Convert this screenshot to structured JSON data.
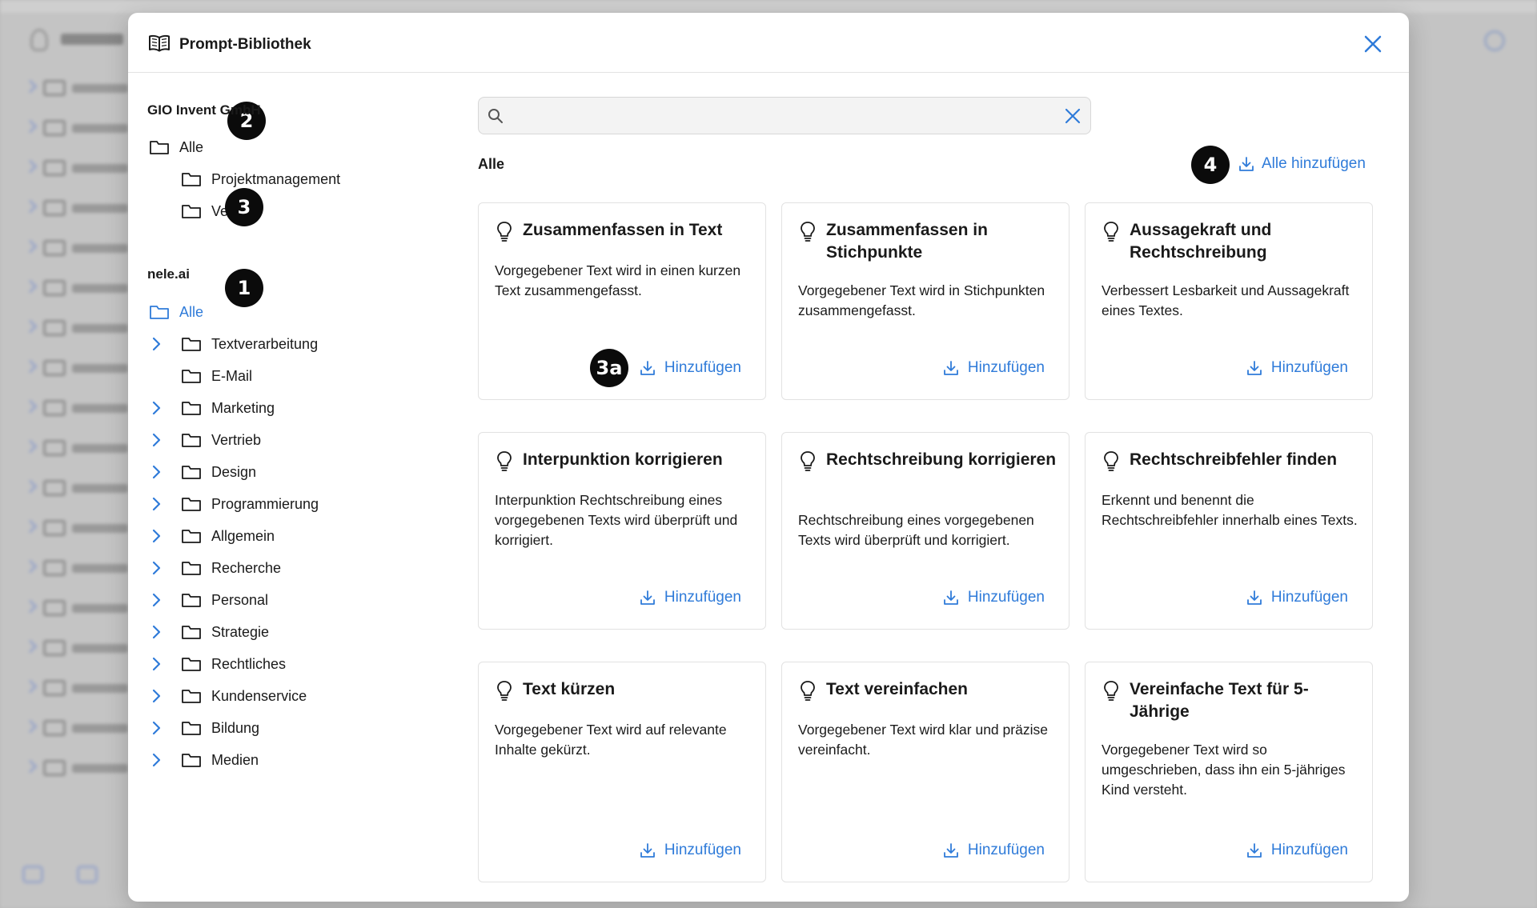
{
  "modal": {
    "title": "Prompt-Bibliothek"
  },
  "sidebar": {
    "groups": [
      {
        "title": "GIO Invent GmbH",
        "badge": "2",
        "items": [
          {
            "label": "Alle",
            "has_chevron": false,
            "active": false
          },
          {
            "label": "Projektmanagement",
            "has_chevron": false,
            "active": false
          },
          {
            "label": "Vertrieb",
            "has_chevron": false,
            "active": false
          }
        ],
        "sub_badge": "3"
      },
      {
        "title": "nele.ai",
        "badge": "1",
        "items": [
          {
            "label": "Alle",
            "has_chevron": false,
            "active": true
          },
          {
            "label": "Textverarbeitung",
            "has_chevron": true,
            "active": false
          },
          {
            "label": "E-Mail",
            "has_chevron": false,
            "active": false
          },
          {
            "label": "Marketing",
            "has_chevron": true,
            "active": false
          },
          {
            "label": "Vertrieb",
            "has_chevron": true,
            "active": false
          },
          {
            "label": "Design",
            "has_chevron": true,
            "active": false
          },
          {
            "label": "Programmierung",
            "has_chevron": true,
            "active": false
          },
          {
            "label": "Allgemein",
            "has_chevron": true,
            "active": false
          },
          {
            "label": "Recherche",
            "has_chevron": true,
            "active": false
          },
          {
            "label": "Personal",
            "has_chevron": true,
            "active": false
          },
          {
            "label": "Strategie",
            "has_chevron": true,
            "active": false
          },
          {
            "label": "Rechtliches",
            "has_chevron": true,
            "active": false
          },
          {
            "label": "Kundenservice",
            "has_chevron": true,
            "active": false
          },
          {
            "label": "Bildung",
            "has_chevron": true,
            "active": false
          },
          {
            "label": "Medien",
            "has_chevron": true,
            "active": false
          }
        ]
      }
    ]
  },
  "search": {
    "value": "",
    "placeholder": ""
  },
  "main": {
    "section_label": "Alle",
    "add_all_label": "Alle hinzufügen",
    "add_all_badge": "4",
    "card_badge": "3a",
    "add_label": "Hinzufügen",
    "cards": [
      {
        "title": "Zusammenfassen in Text",
        "description": "Vorgegebener Text wird in einen kurzen Text zusammengefasst."
      },
      {
        "title": "Zusammenfassen in Stichpunkte",
        "description": "Vorgegebener Text wird in Stichpunkten zusammengefasst."
      },
      {
        "title": "Aussagekraft und Rechtschreibung",
        "description": "Verbessert Lesbarkeit und Aussagekraft eines Textes."
      },
      {
        "title": "Interpunktion korrigieren",
        "description": "Interpunktion Rechtschreibung eines vorgegebenen Texts wird überprüft und korrigiert."
      },
      {
        "title": "Rechtschreibung korrigieren",
        "description": "Rechtschreibung eines vorgegebenen Texts wird überprüft und korrigiert."
      },
      {
        "title": "Rechtschreibfehler finden",
        "description": "Erkennt und benennt die Rechtschreibfehler innerhalb eines Texts."
      },
      {
        "title": "Text kürzen",
        "description": "Vorgegebener Text wird auf relevante Inhalte gekürzt."
      },
      {
        "title": "Text vereinfachen",
        "description": "Vorgegebener Text wird klar und präzise vereinfacht."
      },
      {
        "title": "Vereinfache Text für 5-Jährige",
        "description": "Vorgegebener Text wird so umgeschrieben, dass ihn ein 5-jähriges Kind versteht."
      }
    ]
  },
  "colors": {
    "accent": "#2f7bd9",
    "badge": "#0b0b0b",
    "overlay": "#b9b9b9"
  },
  "icons": {
    "title": "book-open-icon",
    "close": "close-icon",
    "folder": "folder-icon",
    "chevron": "chevron-right-icon",
    "search": "search-icon",
    "clear": "clear-icon",
    "bulb": "lightbulb-icon",
    "download": "download-icon"
  }
}
